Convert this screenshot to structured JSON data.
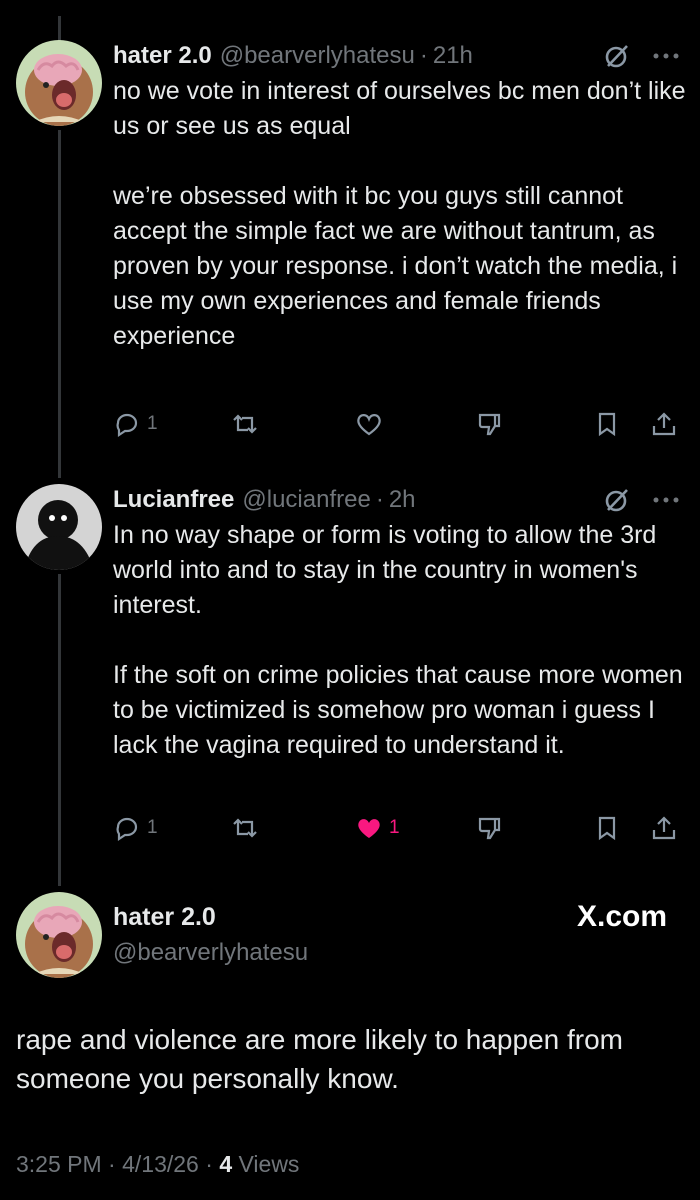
{
  "tweets": [
    {
      "name": "hater 2.0",
      "handle": "@bearverlyhatesu",
      "time": "21h",
      "paragraphs": [
        "no we vote in interest of ourselves bc men don’t like us or see us as equal",
        "we’re obsessed with it bc you guys still cannot accept the simple fact we are without tantrum, as proven by your response. i don’t watch the media, i use my own experiences and female friends experience"
      ],
      "replies": "1",
      "likes": "",
      "liked": false,
      "avatar": "capybara-avatar"
    },
    {
      "name": "Lucianfree",
      "handle": "@lucianfree",
      "time": "2h",
      "paragraphs": [
        "In no way shape or form is voting to allow the 3rd world into and to stay in the country in women's interest.",
        "If the soft on crime policies that cause more women to be victimized is somehow pro woman i guess I lack the vagina required to understand it."
      ],
      "replies": "1",
      "likes": "1",
      "liked": true,
      "avatar": "dark-figure-avatar"
    }
  ],
  "main_post": {
    "name": "hater 2.0",
    "handle": "@bearverlyhatesu",
    "watermark": "X.com",
    "text": "rape and violence are more likely to happen from someone you personally know.",
    "time": "3:25 PM",
    "date": "4/13/26",
    "views_count": "4",
    "views_label": "Views"
  },
  "separator": "·",
  "colors": {
    "background": "#000000",
    "text": "#e7e9ea",
    "muted": "#71767b",
    "like": "#f91880",
    "thread_line": "#333639"
  }
}
